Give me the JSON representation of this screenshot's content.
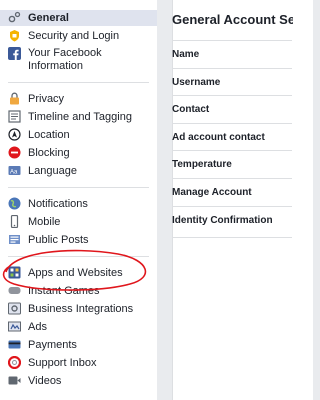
{
  "sidebar": {
    "groups": [
      [
        {
          "label": "General",
          "icon": "gear-icon",
          "active": true
        },
        {
          "label": "Security and Login",
          "icon": "shield-icon"
        },
        {
          "label": "Your Facebook Information",
          "icon": "facebook-icon",
          "tall": true
        }
      ],
      [
        {
          "label": "Privacy",
          "icon": "lock-icon"
        },
        {
          "label": "Timeline and Tagging",
          "icon": "timeline-icon"
        },
        {
          "label": "Location",
          "icon": "location-icon"
        },
        {
          "label": "Blocking",
          "icon": "blocking-icon"
        },
        {
          "label": "Language",
          "icon": "language-icon"
        }
      ],
      [
        {
          "label": "Notifications",
          "icon": "globe-icon"
        },
        {
          "label": "Mobile",
          "icon": "mobile-icon"
        },
        {
          "label": "Public Posts",
          "icon": "public-posts-icon"
        }
      ],
      [
        {
          "label": "Apps and Websites",
          "icon": "apps-icon"
        },
        {
          "label": "Instant Games",
          "icon": "games-icon"
        },
        {
          "label": "Business Integrations",
          "icon": "business-integrations-icon"
        },
        {
          "label": "Ads",
          "icon": "ads-icon"
        },
        {
          "label": "Payments",
          "icon": "payments-icon"
        },
        {
          "label": "Support Inbox",
          "icon": "support-inbox-icon"
        },
        {
          "label": "Videos",
          "icon": "videos-icon"
        }
      ]
    ]
  },
  "main": {
    "title": "General Account Setti",
    "rows": [
      "Name",
      "Username",
      "Contact",
      "Ad account contact",
      "Temperature",
      "Manage Account",
      "Identity Confirmation"
    ]
  },
  "colors": {
    "facebook_blue": "#3b5998",
    "annotation_red": "#e0161c",
    "active_bg": "#dfe3ee",
    "page_bg": "#e9ebee"
  }
}
